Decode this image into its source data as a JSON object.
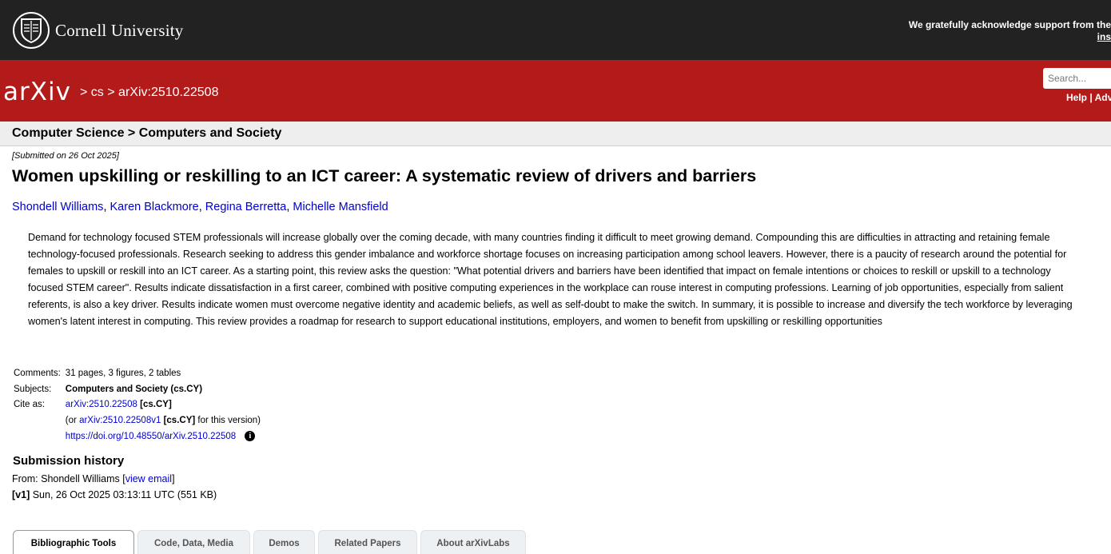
{
  "header": {
    "cornell_name": "Cornell University",
    "acknowledgement": "We gratefully acknowledge support from the",
    "acknowledgement_link": "ins"
  },
  "nav": {
    "logo_text": "arXiv",
    "breadcrumb_sep1": ">",
    "breadcrumb_cs": "cs",
    "breadcrumb_sep2": ">",
    "breadcrumb_id": "arXiv:2510.22508",
    "search_placeholder": "Search...",
    "help_label": "Help",
    "help_sep": "|",
    "advanced_label": "Adv"
  },
  "subject_header": "Computer Science > Computers and Society",
  "paper": {
    "submitted": "[Submitted on 26 Oct 2025]",
    "title": "Women upskilling or reskilling to an ICT career: A systematic review of drivers and barriers",
    "authors": [
      "Shondell Williams",
      "Karen Blackmore",
      "Regina Berretta",
      "Michelle Mansfield"
    ],
    "abstract": "Demand for technology focused STEM professionals will increase globally over the coming decade, with many countries finding it difficult to meet growing demand. Compounding this are difficulties in attracting and retaining female technology-focused professionals. Research seeking to address this gender imbalance and workforce shortage focuses on increasing participation among school leavers. However, there is a paucity of research around the potential for females to upskill or reskill into an ICT career. As a starting point, this review asks the question: \"What potential drivers and barriers have been identified that impact on female intentions or choices to reskill or upskill to a technology focused STEM career\". Results indicate dissatisfaction in a first career, combined with positive computing experiences in the workplace can rouse interest in computing professions. Learning of job opportunities, especially from salient referents, is also a key driver. Results indicate women must overcome negative identity and academic beliefs, as well as self-doubt to make the switch. In summary, it is possible to increase and diversify the tech workforce by leveraging women's latent interest in computing. This review provides a roadmap for research to support educational institutions, employers, and women to benefit from upskilling or reskilling opportunities"
  },
  "metadata": {
    "comments_label": "Comments:",
    "comments_value": "31 pages, 3 figures, 2 tables",
    "subjects_label": "Subjects:",
    "subjects_value": "Computers and Society (cs.CY)",
    "cite_label": "Cite as:",
    "cite_id": "arXiv:2510.22508",
    "cite_cat": "[cs.CY]",
    "version_prefix": "(or",
    "version_id": "arXiv:2510.22508v1",
    "version_cat": "[cs.CY]",
    "version_suffix": "for this version)",
    "doi": "https://doi.org/10.48550/arXiv.2510.22508",
    "info_glyph": "i"
  },
  "history": {
    "title": "Submission history",
    "from_prefix": "From: Shondell Williams [",
    "view_email": "view email",
    "from_suffix": "]",
    "v1_label": "[v1]",
    "v1_text": "Sun, 26 Oct 2025 03:13:11 UTC (551 KB)"
  },
  "tabs": [
    "Bibliographic Tools",
    "Code, Data, Media",
    "Demos",
    "Related Papers",
    "About arXivLabs"
  ],
  "colors": {
    "top_bar": "#222222",
    "brand_red": "#b31b1b",
    "link_blue": "#0000cc",
    "subject_bar": "#eeeeee"
  }
}
